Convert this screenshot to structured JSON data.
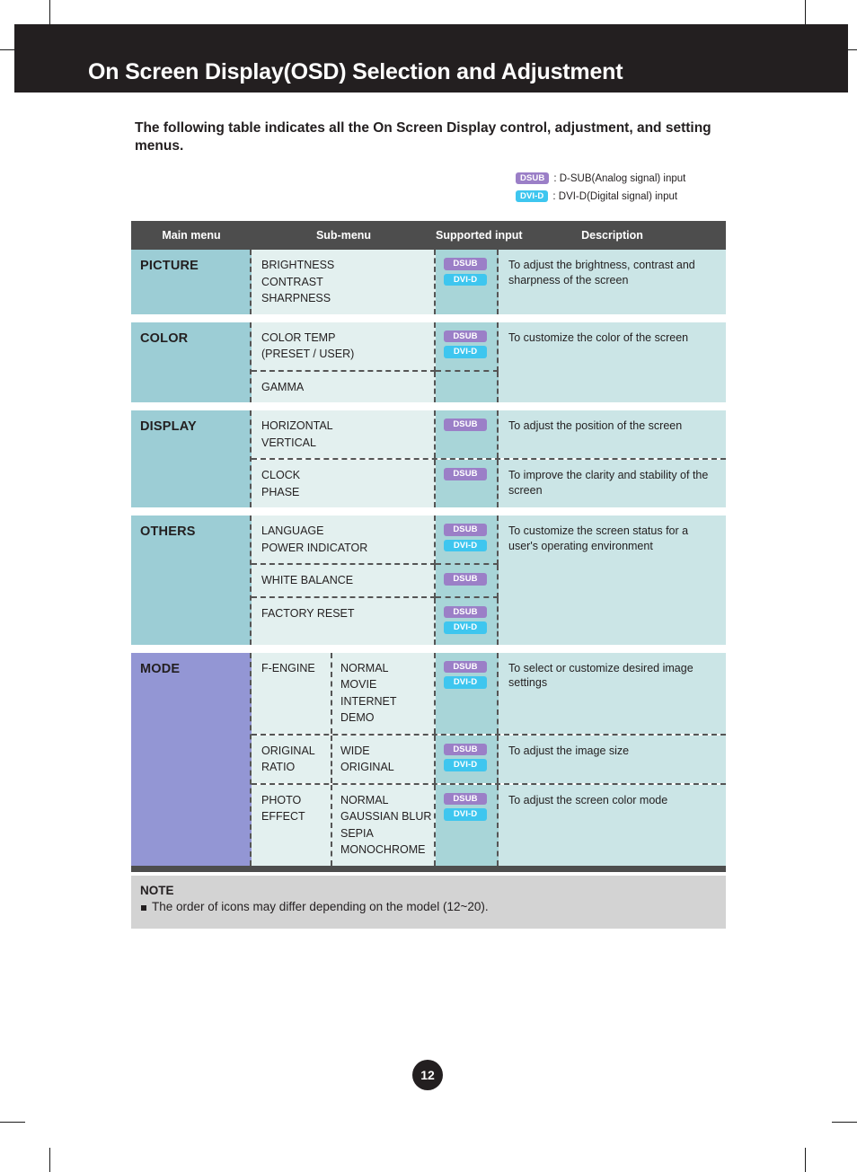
{
  "page": {
    "header_title": "On Screen Display(OSD) Selection and Adjustment",
    "intro": "The following table indicates all the On Screen Display control, adjustment, and setting menus.",
    "page_number": "12"
  },
  "legend": [
    {
      "badge": "DSUB",
      "type": "dsub",
      "text": ": D-SUB(Analog signal) input"
    },
    {
      "badge": "DVI-D",
      "type": "dvid",
      "text": ": DVI-D(Digital signal) input"
    }
  ],
  "table": {
    "headers": {
      "main_menu": "Main menu",
      "sub_menu": "Sub-menu",
      "supported_input": "Supported input",
      "description": "Description"
    },
    "sections": [
      {
        "main": "PICTURE",
        "accent": "#9ccdd5",
        "rows": [
          {
            "sub": "BRIGHTNESS\nCONTRAST\nSHARPNESS",
            "inputs": [
              "DSUB",
              "DVI-D"
            ],
            "desc": "To adjust the brightness, contrast and sharpness of the screen"
          }
        ]
      },
      {
        "main": "COLOR",
        "accent": "#9ccdd5",
        "rows": [
          {
            "sub": "COLOR TEMP\n  (PRESET / USER)",
            "inputs": [
              "DSUB",
              "DVI-D"
            ],
            "desc": "To customize the color of the screen"
          },
          {
            "sub": "GAMMA",
            "inputs": [],
            "desc": ""
          }
        ]
      },
      {
        "main": "DISPLAY",
        "accent": "#9ccdd5",
        "rows": [
          {
            "sub": "HORIZONTAL\nVERTICAL",
            "inputs": [
              "DSUB"
            ],
            "desc": "To adjust the position of the screen"
          },
          {
            "sub": "CLOCK\nPHASE",
            "inputs": [
              "DSUB"
            ],
            "desc": "To improve the clarity and stability of the screen"
          }
        ]
      },
      {
        "main": "OTHERS",
        "accent": "#9ccdd5",
        "rows": [
          {
            "sub": "LANGUAGE\nPOWER INDICATOR",
            "inputs": [
              "DSUB",
              "DVI-D"
            ],
            "desc": "To customize the screen status for a user's operating environment"
          },
          {
            "sub": "WHITE BALANCE",
            "inputs": [
              "DSUB"
            ],
            "desc": ""
          },
          {
            "sub": "FACTORY RESET",
            "inputs": [
              "DSUB",
              "DVI-D"
            ],
            "desc": ""
          }
        ]
      },
      {
        "main": "MODE",
        "accent": "#9396d4",
        "rows": [
          {
            "sub_left": "F-ENGINE",
            "sub_right": "NORMAL\nMOVIE\nINTERNET\nDEMO",
            "inputs": [
              "DSUB",
              "DVI-D"
            ],
            "desc": "To select or customize desired image settings"
          },
          {
            "sub_left": "ORIGINAL\nRATIO",
            "sub_right": "WIDE\nORIGINAL",
            "inputs": [
              "DSUB",
              "DVI-D"
            ],
            "desc": "To adjust the image size"
          },
          {
            "sub_left": "PHOTO\nEFFECT",
            "sub_right": "NORMAL\nGAUSSIAN BLUR\nSEPIA\nMONOCHROME",
            "inputs": [
              "DSUB",
              "DVI-D"
            ],
            "desc": "To adjust the screen color mode"
          }
        ]
      }
    ]
  },
  "note": {
    "title": "NOTE",
    "text": "The order of icons may differ depending on the model (12~20)."
  },
  "colors": {
    "header_bar": "#231f20",
    "table_header": "#4d4d4d",
    "main_teal": "#9ccdd5",
    "main_purple": "#9396d4",
    "sub_bg": "#e3f0ef",
    "input_bg": "#a8d5d8",
    "desc_bg": "#cbe5e6",
    "badge_dsub": "#9b7fc7",
    "badge_dvid": "#3ec6ef",
    "note_bg": "#d3d3d3"
  }
}
